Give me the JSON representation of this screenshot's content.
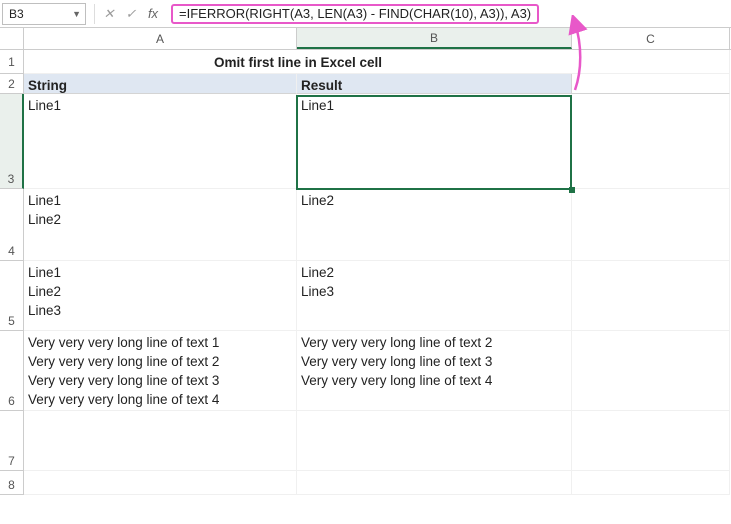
{
  "nameBox": {
    "value": "B3"
  },
  "formulaBar": {
    "cancel": "✕",
    "enter": "✓",
    "fx": "fx",
    "formula": "=IFERROR(RIGHT(A3, LEN(A3) - FIND(CHAR(10), A3)), A3)"
  },
  "columns": {
    "A": "A",
    "B": "B",
    "C": "C"
  },
  "rowLabels": {
    "r1": "1",
    "r2": "2",
    "r3": "3",
    "r4": "4",
    "r5": "5",
    "r6": "6",
    "r7": "7",
    "r8": "8"
  },
  "title": "Omit first line in Excel cell",
  "headers": {
    "col1": "String",
    "col2": "Result"
  },
  "rows": [
    {
      "a": "Line1",
      "b": "Line1",
      "heightPx": 95
    },
    {
      "a": "Line1\nLine2",
      "b": "Line2",
      "heightPx": 72
    },
    {
      "a": "Line1\nLine2\nLine3",
      "b": "Line2\nLine3",
      "heightPx": 70
    },
    {
      "a": "Very very very long line of text 1\nVery very very long line of text 2\nVery very very long line of text 3\nVery very very long line of text 4",
      "b": "Very very very long line of text 2\nVery very very long line of text 3\nVery very very long line of text 4",
      "heightPx": 80
    },
    {
      "a": "",
      "b": "",
      "heightPx": 60
    },
    {
      "a": "",
      "b": "",
      "heightPx": 24
    }
  ],
  "colors": {
    "accent": "#1f7246",
    "highlight": "#e858c9",
    "headerFill": "#dfe7f2"
  }
}
